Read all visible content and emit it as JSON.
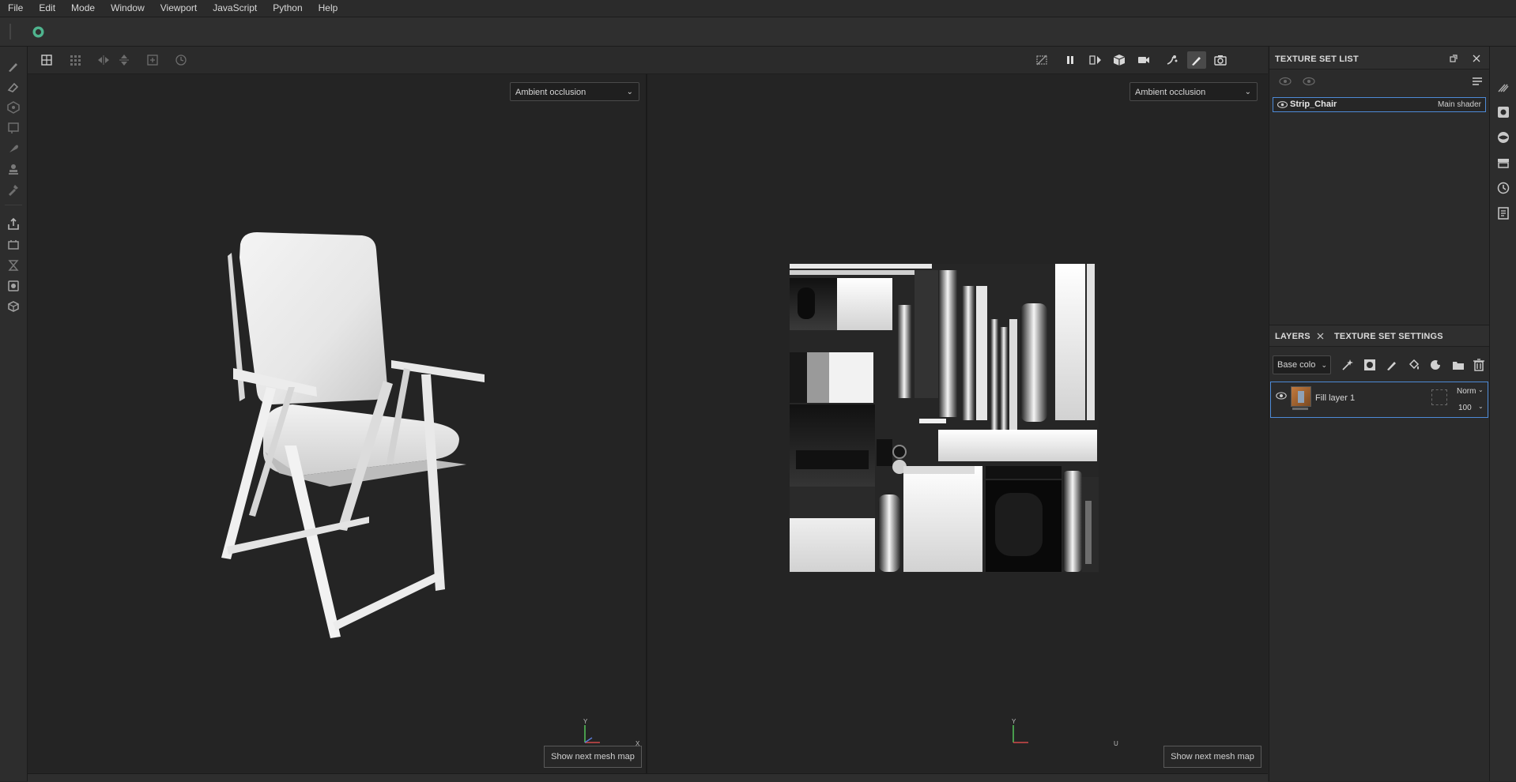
{
  "menu": [
    "File",
    "Edit",
    "Mode",
    "Window",
    "Viewport",
    "JavaScript",
    "Python",
    "Help"
  ],
  "viewport_3d": {
    "channel_dropdown": "Ambient occlusion",
    "mesh_map_button": "Show next mesh map",
    "axis_y": "Y",
    "axis_x": "X"
  },
  "viewport_2d": {
    "channel_dropdown": "Ambient occlusion",
    "mesh_map_button": "Show next mesh map",
    "axis_y": "Y",
    "axis_u": "U"
  },
  "texture_set_list": {
    "title": "TEXTURE SET LIST",
    "items": [
      {
        "name": "Strip_Chair",
        "shader": "Main shader"
      }
    ]
  },
  "layers_panel": {
    "tabs": [
      "LAYERS",
      "TEXTURE SET SETTINGS"
    ],
    "channel_select": "Base colo",
    "layers": [
      {
        "name": "Fill layer 1",
        "blend": "Norm",
        "opacity": "100"
      }
    ]
  },
  "colors": {
    "accent": "#4d8ad6",
    "logo": "#4fb48e"
  }
}
